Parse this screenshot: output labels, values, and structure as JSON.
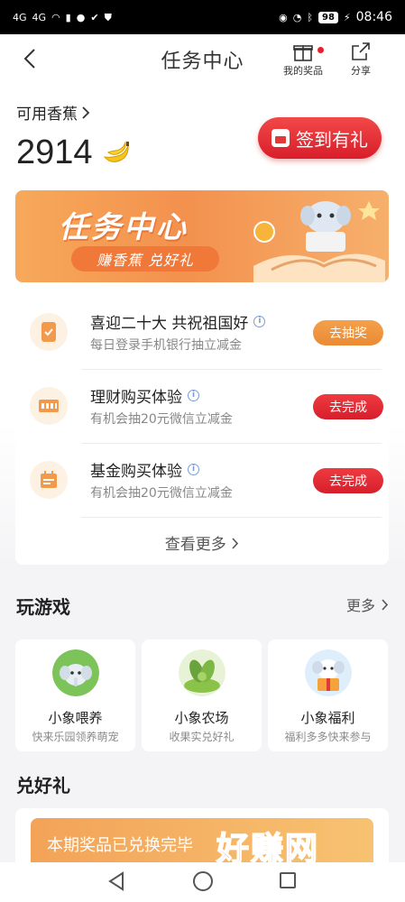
{
  "status_bar": {
    "signal_1": "4G",
    "signal_2": "4G",
    "battery": "98",
    "time": "08:46"
  },
  "header": {
    "title": "任务中心",
    "prizes_label": "我的奖品",
    "share_label": "分享"
  },
  "banana": {
    "label": "可用香蕉",
    "count": "2914",
    "signin_label": "签到有礼"
  },
  "banner": {
    "title": "任务中心",
    "subtitle": "赚香蕉 兑好礼"
  },
  "tasks": [
    {
      "title": "喜迎二十大 共祝祖国好",
      "subtitle": "每日登录手机银行抽立减金",
      "button": "去抽奖",
      "button_color": "#ea8a35",
      "icon": "phone-icon"
    },
    {
      "title": "理财购买体验",
      "subtitle": "有机会抽20元微信立减金",
      "button": "去完成",
      "button_color": "#d71f2c",
      "icon": "wealth-icon"
    },
    {
      "title": "基金购买体验",
      "subtitle": "有机会抽20元微信立减金",
      "button": "去完成",
      "button_color": "#d71f2c",
      "icon": "calendar-icon"
    }
  ],
  "view_more": "查看更多",
  "games": {
    "title": "玩游戏",
    "more": "更多",
    "items": [
      {
        "name": "小象喂养",
        "subtitle": "快来乐园领养萌宠"
      },
      {
        "name": "小象农场",
        "subtitle": "收果实兑好礼"
      },
      {
        "name": "小象福利",
        "subtitle": "福利多多快来参与"
      }
    ]
  },
  "redeem": {
    "title": "兑好礼",
    "banner_text": "本期奖品已兑换完毕"
  },
  "watermark": {
    "text": "好赚网",
    "url": "zhuanyes.com"
  },
  "colors": {
    "accent_red": "#d81e2a",
    "accent_orange": "#f3914e"
  }
}
